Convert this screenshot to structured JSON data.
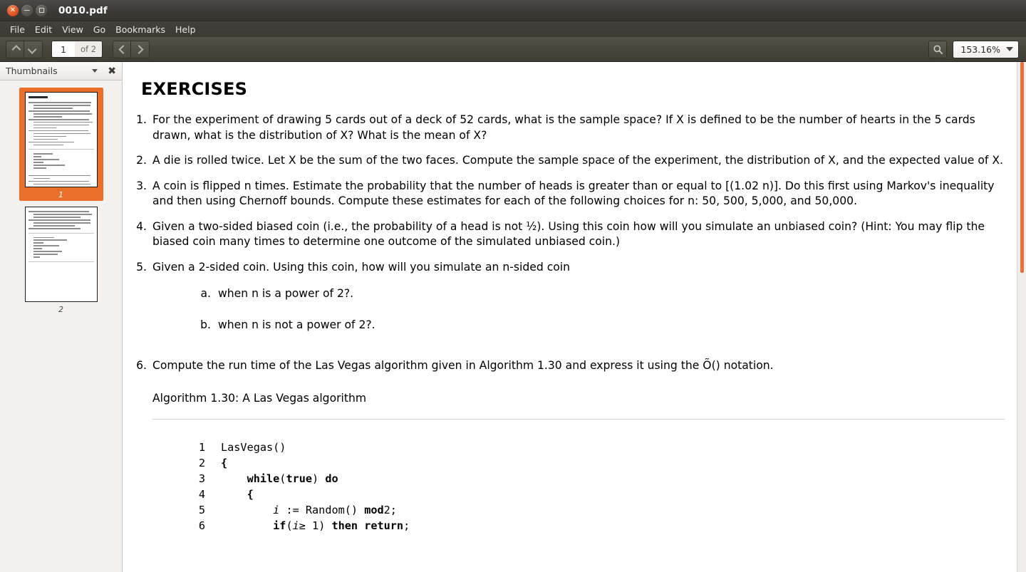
{
  "window": {
    "title": "0010.pdf",
    "buttons": {
      "close": "×",
      "minimize": "–",
      "maximize": "□"
    }
  },
  "menubar": {
    "items": [
      "File",
      "Edit",
      "View",
      "Go",
      "Bookmarks",
      "Help"
    ]
  },
  "toolbar": {
    "page_number": "1",
    "page_total": "of 2",
    "zoom_level": "153.16%",
    "prev_page_icon": "chevron-up-icon",
    "next_page_icon": "chevron-down-icon",
    "history_back_icon": "chevron-left-icon",
    "history_forward_icon": "chevron-right-icon",
    "search_icon": "search-icon"
  },
  "sidebar": {
    "title": "Thumbnails",
    "close_label": "✖",
    "thumbnails": [
      {
        "label": "1",
        "selected": true
      },
      {
        "label": "2",
        "selected": false
      }
    ]
  },
  "document": {
    "heading": "EXERCISES",
    "items": [
      {
        "marker": "1.",
        "text": "For the experiment of drawing 5 cards out of a deck of 52 cards, what is the sample space? If X is defined to be the number of hearts in the 5 cards drawn, what is the distribution of X? What is the mean of X?"
      },
      {
        "marker": "2.",
        "text": "A die is rolled twice. Let X be the sum of the two faces. Compute the sample space of the experiment, the distribution of X, and the expected value of X."
      },
      {
        "marker": "3.",
        "text": "A coin is flipped n times. Estimate the probability that the number of heads is greater than or equal to [(1.02 n)]. Do this first using Markov's inequality and then using Chernoff bounds. Compute these estimates for each of the following choices for n: 50, 500, 5,000, and 50,000."
      },
      {
        "marker": "4.",
        "text": "Given a two-sided biased coin (i.e., the probability of a head is not ½). Using this coin how will you simulate an unbiased coin? (Hint: You may flip the biased coin many times to determine one outcome of the simulated unbiased coin.)"
      },
      {
        "marker": "5.",
        "text": "Given a 2-sided coin. Using this coin, how will you simulate an n-sided coin",
        "subitems": [
          {
            "marker": "a.",
            "text": "when n is a power of 2?."
          },
          {
            "marker": "b.",
            "text": "when n is not a power of 2?."
          }
        ]
      },
      {
        "marker": "6.",
        "text": "Compute the run time of the Las Vegas algorithm given in Algorithm 1.30 and express it using the Õ() notation.",
        "algorithm_caption": "Algorithm 1.30: A Las Vegas algorithm"
      }
    ],
    "code_lines": [
      {
        "num": "1",
        "text": "LasVegas()"
      },
      {
        "num": "2",
        "text": "{"
      },
      {
        "num": "3",
        "text": "    while(true) do"
      },
      {
        "num": "4",
        "text": "    {"
      },
      {
        "num": "5",
        "text": "        i := Random() mod2;"
      },
      {
        "num": "6",
        "text": "        if(i≥ 1) then return;"
      }
    ]
  },
  "colors": {
    "titlebar": "#3b3a36",
    "toolbar": "#474439",
    "accent_orange": "#ea7029",
    "scrollbar_thumb": "#e8703a",
    "sidebar_bg": "#f2f1f0"
  }
}
